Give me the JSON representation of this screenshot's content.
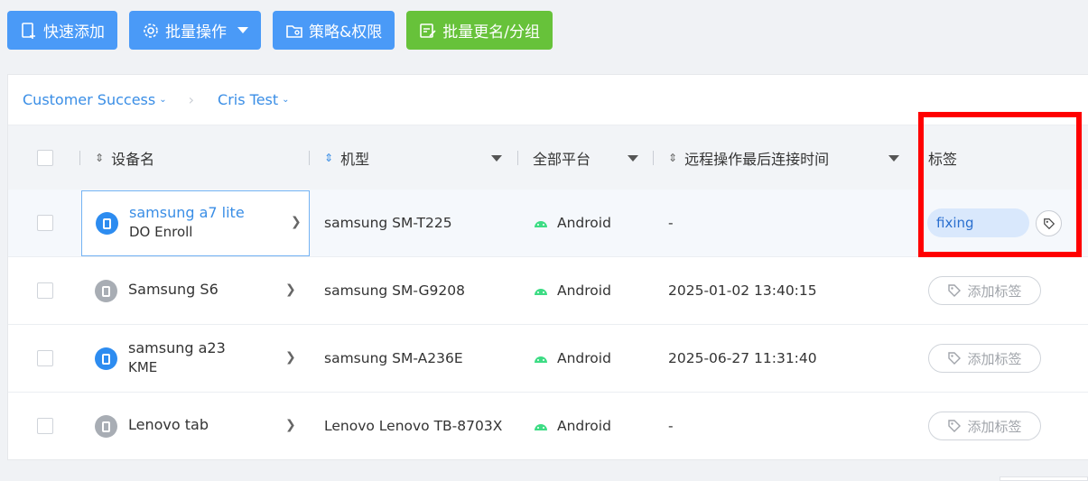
{
  "toolbar": {
    "quick_add": "快速添加",
    "batch_ops": "批量操作",
    "policy_perm": "策略&权限",
    "batch_rename": "批量更名/分组"
  },
  "breadcrumb": {
    "org": "Customer Success",
    "group": "Cris Test"
  },
  "table": {
    "headers": {
      "device_name": "设备名",
      "model": "机型",
      "platform": "全部平台",
      "last_conn": "远程操作最后连接时间",
      "tags": "标签"
    },
    "rows": [
      {
        "name": "samsung a7 lite",
        "sub": "DO Enroll",
        "icon": "phone-icon",
        "icon_color": "#2d8cf0",
        "model": "samsung SM-T225",
        "platform": "Android",
        "last_conn": "-",
        "tag": "fixing"
      },
      {
        "name": "Samsung S6",
        "sub": "",
        "icon": "phone-icon",
        "icon_color": "#a8adb4",
        "model": "samsung SM-G9208",
        "platform": "Android",
        "last_conn": "2025-01-02 13:40:15",
        "add_tag": "添加标签"
      },
      {
        "name": "samsung a23",
        "sub": "KME",
        "icon": "phone-icon",
        "icon_color": "#2d8cf0",
        "model": "samsung SM-A236E",
        "platform": "Android",
        "last_conn": "2025-06-27 11:31:40",
        "add_tag": "添加标签"
      },
      {
        "name": "Lenovo tab",
        "sub": "",
        "icon": "phone-icon",
        "icon_color": "#a8adb4",
        "model": "Lenovo Lenovo TB-8703X",
        "platform": "Android",
        "last_conn": "-",
        "add_tag": "添加标签"
      }
    ]
  },
  "colors": {
    "primary": "#4a9af7",
    "success": "#67c23a",
    "highlight_box": "#ff0000"
  }
}
